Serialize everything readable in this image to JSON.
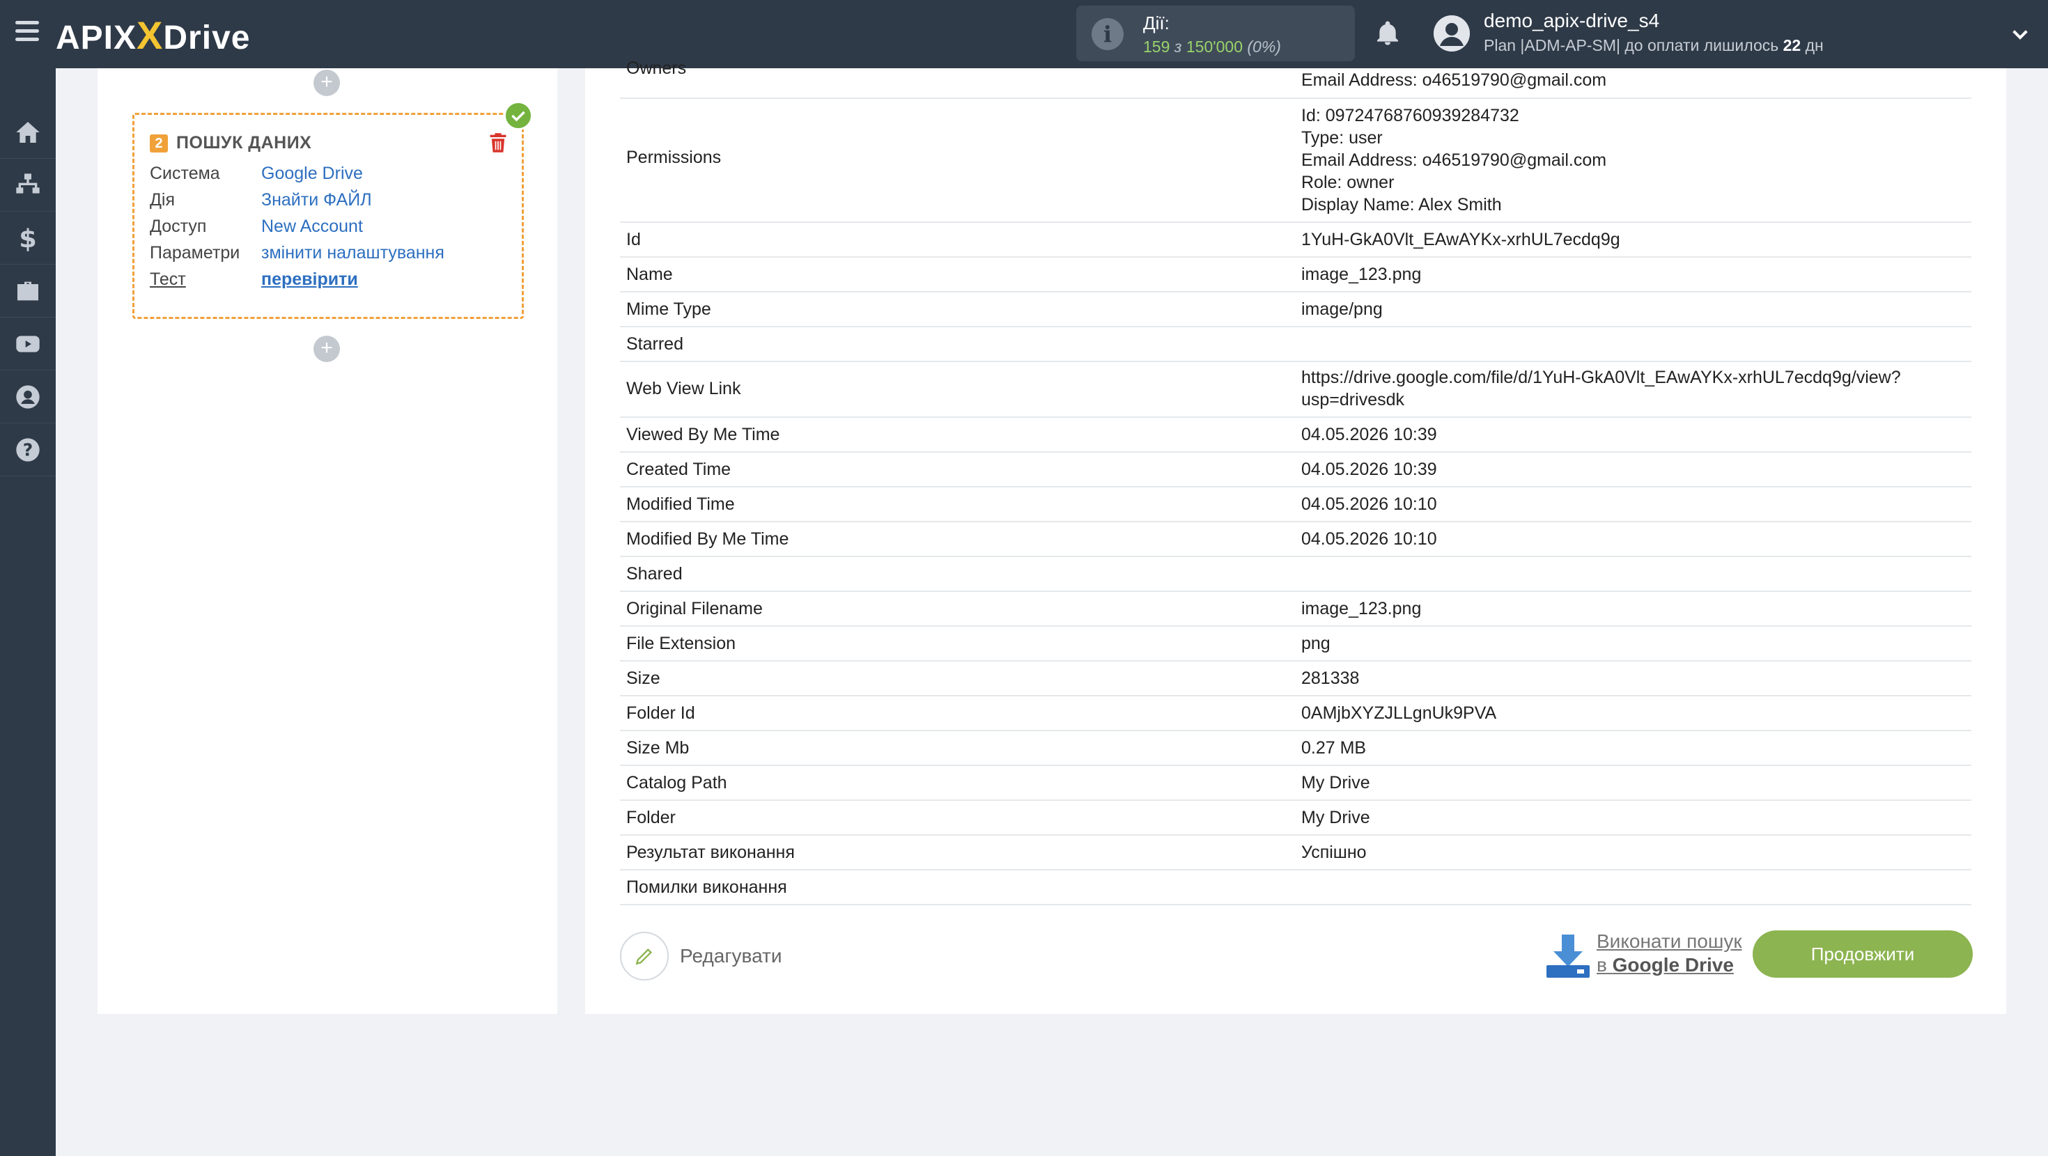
{
  "header": {
    "logo_left": "APIX",
    "logo_right": "Drive",
    "actions_label": "Дії:",
    "actions_used": "159",
    "actions_of": "з",
    "actions_total": "150'000",
    "actions_pct": "(0%)",
    "username": "demo_apix-drive_s4",
    "plan_text": "Plan |ADM-AP-SM| до оплати лишилось",
    "plan_days": "22",
    "plan_days_unit": "дн"
  },
  "sidebar": {
    "items": [
      "home-icon",
      "sitemap-icon",
      "dollar-icon",
      "briefcase-icon",
      "youtube-icon",
      "user-icon",
      "help-icon"
    ]
  },
  "block": {
    "number": "2",
    "title": "ПОШУК ДАНИХ",
    "rows": [
      {
        "key": "Система",
        "value": "Google Drive"
      },
      {
        "key": "Дія",
        "value": "Знайти ФАЙЛ"
      },
      {
        "key": "Доступ",
        "value": "New Account"
      },
      {
        "key": "Параметри",
        "value": "змінити налаштування"
      },
      {
        "key": "Тест",
        "value": "перевірити"
      }
    ]
  },
  "results": {
    "rows": [
      {
        "key": "Owners",
        "value": "Email Address: o46519790@gmail.com"
      },
      {
        "key": "Permissions",
        "value_lines": [
          "Id: 09724768760939284732",
          "Type: user",
          "Email Address: o46519790@gmail.com",
          "Role: owner",
          "Display Name: Alex Smith"
        ]
      },
      {
        "key": "Id",
        "value": "1YuH-GkA0Vlt_EAwAYKx-xrhUL7ecdq9g"
      },
      {
        "key": "Name",
        "value": "image_123.png"
      },
      {
        "key": "Mime Type",
        "value": "image/png"
      },
      {
        "key": "Starred",
        "value": ""
      },
      {
        "key": "Web View Link",
        "value_lines": [
          "https://drive.google.com/file/d/1YuH-GkA0Vlt_EAwAYKx-xrhUL7ecdq9g/view?",
          "usp=drivesdk"
        ]
      },
      {
        "key": "Viewed By Me Time",
        "value": "04.05.2026 10:39"
      },
      {
        "key": "Created Time",
        "value": "04.05.2026 10:39"
      },
      {
        "key": "Modified Time",
        "value": "04.05.2026 10:10"
      },
      {
        "key": "Modified By Me Time",
        "value": "04.05.2026 10:10"
      },
      {
        "key": "Shared",
        "value": ""
      },
      {
        "key": "Original Filename",
        "value": "image_123.png"
      },
      {
        "key": "File Extension",
        "value": "png"
      },
      {
        "key": "Size",
        "value": "281338"
      },
      {
        "key": "Folder Id",
        "value": "0AMjbXYZJLLgnUk9PVA"
      },
      {
        "key": "Size Mb",
        "value": "0.27 MB"
      },
      {
        "key": "Catalog Path",
        "value": "My Drive"
      },
      {
        "key": "Folder",
        "value": "My Drive"
      },
      {
        "key": "Результат виконання",
        "value": "Успішно"
      },
      {
        "key": "Помилки виконання",
        "value": ""
      }
    ]
  },
  "footer": {
    "edit_label": "Редагувати",
    "search_line1": "Виконати пошук",
    "search_line2_prefix": "в",
    "search_line2_service": "Google Drive",
    "continue_label": "Продовжити"
  },
  "colors": {
    "header_bg": "#2f3a48",
    "accent_green": "#8cb451",
    "block_border": "#f0a13a",
    "link_blue": "#2d6fc0"
  }
}
